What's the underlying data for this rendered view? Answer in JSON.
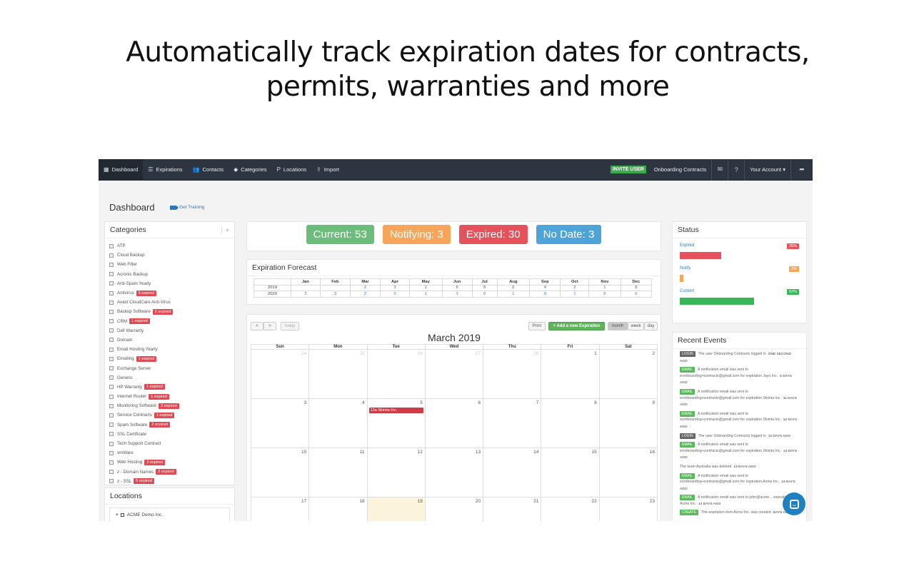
{
  "headline": {
    "line1": "Automatically track expiration dates for contracts,",
    "line2": "permits, warranties and more"
  },
  "nav": {
    "left": [
      {
        "icon": "dashboard-icon",
        "glyph": "▦",
        "label": "Dashboard"
      },
      {
        "icon": "list-icon",
        "glyph": "☰",
        "label": "Expirations"
      },
      {
        "icon": "users-icon",
        "glyph": "👥",
        "label": "Contacts"
      },
      {
        "icon": "tag-icon",
        "glyph": "◆",
        "label": "Categories"
      },
      {
        "icon": "pin-icon",
        "glyph": "P",
        "label": "Locations"
      },
      {
        "icon": "upload-icon",
        "glyph": "⇪",
        "label": "Import"
      }
    ],
    "invite": "INVITE USER",
    "org": "Onboarding Contracts",
    "account": "Your Account ▾",
    "icons": [
      "envelope-icon",
      "help-icon",
      "share-icon"
    ]
  },
  "page": {
    "title": "Dashboard",
    "training": "Get Training"
  },
  "categories": {
    "title": "Categories",
    "add": "+",
    "items": [
      {
        "label": "ATP",
        "badge": ""
      },
      {
        "label": "Cloud Backup",
        "badge": ""
      },
      {
        "label": "Web Filter",
        "badge": ""
      },
      {
        "label": "Acronis Backup",
        "badge": ""
      },
      {
        "label": "Anti-Spam Yearly",
        "badge": ""
      },
      {
        "label": "Antivirus",
        "badge": "6 expired"
      },
      {
        "label": "Avast CloudCare Anti-Virus",
        "badge": ""
      },
      {
        "label": "Backup Software",
        "badge": "6 expired"
      },
      {
        "label": "CRM",
        "badge": "1 expired"
      },
      {
        "label": "Dell Warranty",
        "badge": ""
      },
      {
        "label": "Domain",
        "badge": ""
      },
      {
        "label": "Email Hosting Yearly",
        "badge": ""
      },
      {
        "label": "Emailing",
        "badge": "1 expired"
      },
      {
        "label": "Exchange Server",
        "badge": ""
      },
      {
        "label": "Generic",
        "badge": ""
      },
      {
        "label": "HP Warranty",
        "badge": "1 expired"
      },
      {
        "label": "Internet Router",
        "badge": "1 expired"
      },
      {
        "label": "Monitoring Software",
        "badge": "3 expired"
      },
      {
        "label": "Service Contracts",
        "badge": "1 expired"
      },
      {
        "label": "Spam Software",
        "badge": "2 expired"
      },
      {
        "label": "SSL Certificate",
        "badge": ""
      },
      {
        "label": "Tech Support Contract",
        "badge": ""
      },
      {
        "label": "vmWare",
        "badge": ""
      },
      {
        "label": "Web Hosting",
        "badge": "3 expired"
      },
      {
        "label": "z - Domain Names",
        "badge": "2 expired"
      },
      {
        "label": "z - SSL",
        "badge": "5 expired"
      }
    ]
  },
  "locations": {
    "title": "Locations",
    "items": [
      {
        "label": "ACME Demo Inc."
      }
    ]
  },
  "status_counts": [
    {
      "label": "Current: 53",
      "color": "#6cbd7c"
    },
    {
      "label": "Notifying: 3",
      "color": "#f6a55a"
    },
    {
      "label": "Expired: 30",
      "color": "#e6525b"
    },
    {
      "label": "No Date: 3",
      "color": "#4ea3d8"
    }
  ],
  "forecast": {
    "title": "Expiration Forecast",
    "months": [
      "Jan",
      "Feb",
      "Mar",
      "Apr",
      "May",
      "Jun",
      "Jul",
      "Aug",
      "Sep",
      "Oct",
      "Nov",
      "Dec"
    ],
    "rows": [
      {
        "year": "2019",
        "values": [
          "",
          "",
          "2",
          "3",
          "2",
          "8",
          "8",
          "6",
          "4",
          "2",
          "1",
          "8"
        ]
      },
      {
        "year": "2020",
        "values": [
          "2",
          "3",
          "2",
          "0",
          "1",
          "1",
          "0",
          "1",
          "0",
          "1",
          "0",
          "0"
        ]
      }
    ]
  },
  "calendar": {
    "prev": "<",
    "next": ">",
    "today": "today",
    "title": "March 2019",
    "print": "Print",
    "add": "+ Add a new Expiration",
    "views": [
      "month",
      "week",
      "day"
    ],
    "active_view": "month",
    "dow": [
      "Sun",
      "Mon",
      "Tue",
      "Wed",
      "Thu",
      "Fri",
      "Sat"
    ],
    "weeks": [
      [
        {
          "d": "24",
          "o": true
        },
        {
          "d": "25",
          "o": true
        },
        {
          "d": "26",
          "o": true
        },
        {
          "d": "27",
          "o": true
        },
        {
          "d": "28",
          "o": true
        },
        {
          "d": "1"
        },
        {
          "d": "2"
        }
      ],
      [
        {
          "d": "3"
        },
        {
          "d": "4"
        },
        {
          "d": "5",
          "event": "12a Skimia Inc."
        },
        {
          "d": "6"
        },
        {
          "d": "7"
        },
        {
          "d": "8"
        },
        {
          "d": "9"
        }
      ],
      [
        {
          "d": "10"
        },
        {
          "d": "11"
        },
        {
          "d": "12"
        },
        {
          "d": "13"
        },
        {
          "d": "14"
        },
        {
          "d": "15"
        },
        {
          "d": "16"
        }
      ],
      [
        {
          "d": "17"
        },
        {
          "d": "18"
        },
        {
          "d": "19",
          "today": true
        },
        {
          "d": "20"
        },
        {
          "d": "21"
        },
        {
          "d": "22"
        },
        {
          "d": "23"
        }
      ]
    ]
  },
  "status": {
    "title": "Status",
    "rows": [
      {
        "label": "Expired",
        "pct": "35%",
        "fraction": 0.35,
        "color": "#e6525b"
      },
      {
        "label": "Notify",
        "pct": "3%",
        "fraction": 0.03,
        "color": "#f6a55a"
      },
      {
        "label": "Current",
        "pct": "62%",
        "fraction": 0.62,
        "color": "#3bb55a"
      }
    ]
  },
  "events": {
    "title": "Recent Events",
    "items": [
      {
        "badge": "LOGIN",
        "color": "#666666",
        "text": "The user Onboarding Contracts logged in",
        "when": "ONE SECOND AGO"
      },
      {
        "badge": "EMAIL",
        "color": "#5cb85c",
        "text": "A notification email was sent to eronboarding+contracts@gmail.com for expiration Jayo Inc.",
        "when": "6 DAYS AGO"
      },
      {
        "badge": "EMAIL",
        "color": "#5cb85c",
        "text": "A notification email was sent to eronboarding+contracts@gmail.com for expiration Skimia Inc.",
        "when": "11 DAYS AGO"
      },
      {
        "badge": "EMAIL",
        "color": "#5cb85c",
        "text": "A notification email was sent to eronboarding+contracts@gmail.com for expiration Skimia Inc.",
        "when": "12 DAYS AGO"
      },
      {
        "badge": "LOGIN",
        "color": "#666666",
        "text": "The user Onboarding Contracts logged in",
        "when": "12 DAYS AGO"
      },
      {
        "badge": "EMAIL",
        "color": "#5cb85c",
        "text": "A notification email was sent to eronboarding+contracts@gmail.com for expiration Skimia Inc.",
        "when": "13 DAYS AGO"
      },
      {
        "badge": "",
        "color": "",
        "text": "The team Australia was deleted",
        "when": "13 DAYS AGO"
      },
      {
        "badge": "EMAIL",
        "color": "#5cb85c",
        "text": "A notification email was sent to eronboarding+contracts@gmail.com for expiration Acme Inc.",
        "when": "13 DAYS AGO"
      },
      {
        "badge": "EMAIL",
        "color": "#5cb85c",
        "text": "A notification email was sent to john@acme... expiration Acme Inc.",
        "when": "13 DAYS AGO"
      },
      {
        "badge": "CREATE",
        "color": "#5cb85c",
        "text": "The expiration item Acme Inc. was created",
        "when": "DAYS AGO"
      }
    ]
  }
}
